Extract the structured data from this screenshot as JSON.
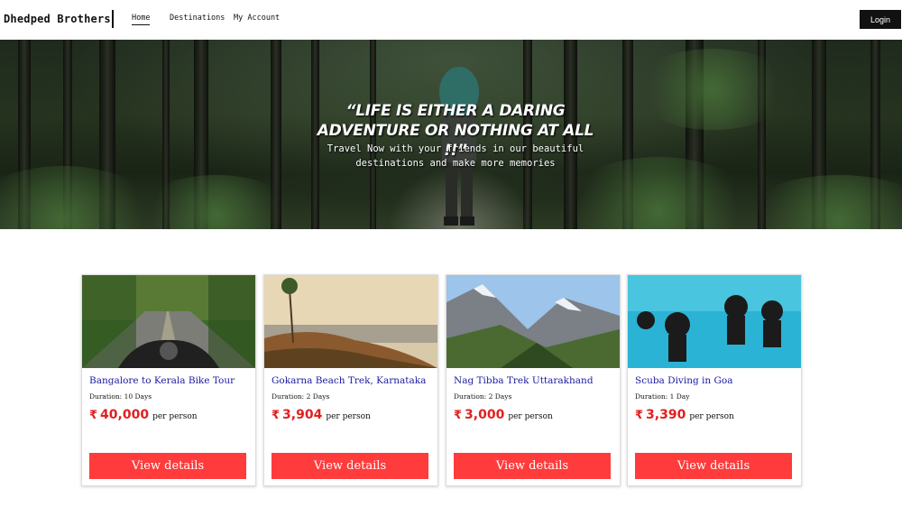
{
  "nav": {
    "brand": "Dhedped Brothers",
    "links": [
      "Home",
      "Destinations",
      "My Account"
    ],
    "login_label": "Login"
  },
  "hero": {
    "quote_line1": "“LIFE IS EITHER A DARING",
    "quote_line2": "ADVENTURE OR NOTHING AT ALL !!”",
    "sub_line1": "Travel Now with your friends in our beautiful",
    "sub_line2": "destinations and make more memories"
  },
  "tours": [
    {
      "title": "Bangalore to Kerala Bike Tour",
      "duration": "Duration: 10 Days",
      "currency": "₹",
      "price": "40,000",
      "per": "per person",
      "button": "View details",
      "image": "road-bike-icon"
    },
    {
      "title": "Gokarna Beach Trek, Karnataka",
      "duration": "Duration: 2 Days",
      "currency": "₹",
      "price": "3,904",
      "per": "per person",
      "button": "View details",
      "image": "beach-cliff-icon"
    },
    {
      "title": "Nag Tibba Trek Uttarakhand",
      "duration": "Duration: 2 Days",
      "currency": "₹",
      "price": "3,000",
      "per": "per person",
      "button": "View details",
      "image": "mountain-icon"
    },
    {
      "title": "Scuba Diving in Goa",
      "duration": "Duration: 1 Day",
      "currency": "₹",
      "price": "3,390",
      "per": "per person",
      "button": "View details",
      "image": "scuba-icon"
    }
  ],
  "colors": {
    "accent": "#ff3b3b",
    "price": "#e02020",
    "title": "#1a1aa0",
    "login_bg": "#111111"
  }
}
